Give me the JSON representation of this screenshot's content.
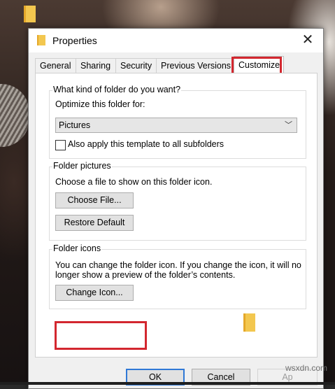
{
  "window": {
    "title": "Properties",
    "close_glyph": "✕"
  },
  "tabs": [
    {
      "label": "General"
    },
    {
      "label": "Sharing"
    },
    {
      "label": "Security"
    },
    {
      "label": "Previous Versions"
    },
    {
      "label": "Customize",
      "selected": true
    }
  ],
  "folder_type": {
    "title": "What kind of folder do you want?",
    "optimize_label": "Optimize this folder for:",
    "selected_option": "Pictures",
    "chevron": "﹀",
    "apply_subfolders_label": "Also apply this template to all subfolders",
    "apply_subfolders_checked": false
  },
  "folder_pictures": {
    "title": "Folder pictures",
    "description": "Choose a file to show on this folder icon.",
    "choose_file_label": "Choose File...",
    "restore_default_label": "Restore Default"
  },
  "folder_icons": {
    "title": "Folder icons",
    "description_line1": "You can change the folder icon. If you change the icon, it will no",
    "description_line2": "longer show a preview of the folder’s contents.",
    "change_icon_label": "Change Icon..."
  },
  "footer": {
    "ok_label": "OK",
    "cancel_label": "Cancel",
    "apply_label": "Ap"
  },
  "watermark": "wsxdn.com",
  "colors": {
    "highlight_red": "#d3272f",
    "default_button_blue": "#2f78d6",
    "folder_yellow": "#f3c74f"
  }
}
